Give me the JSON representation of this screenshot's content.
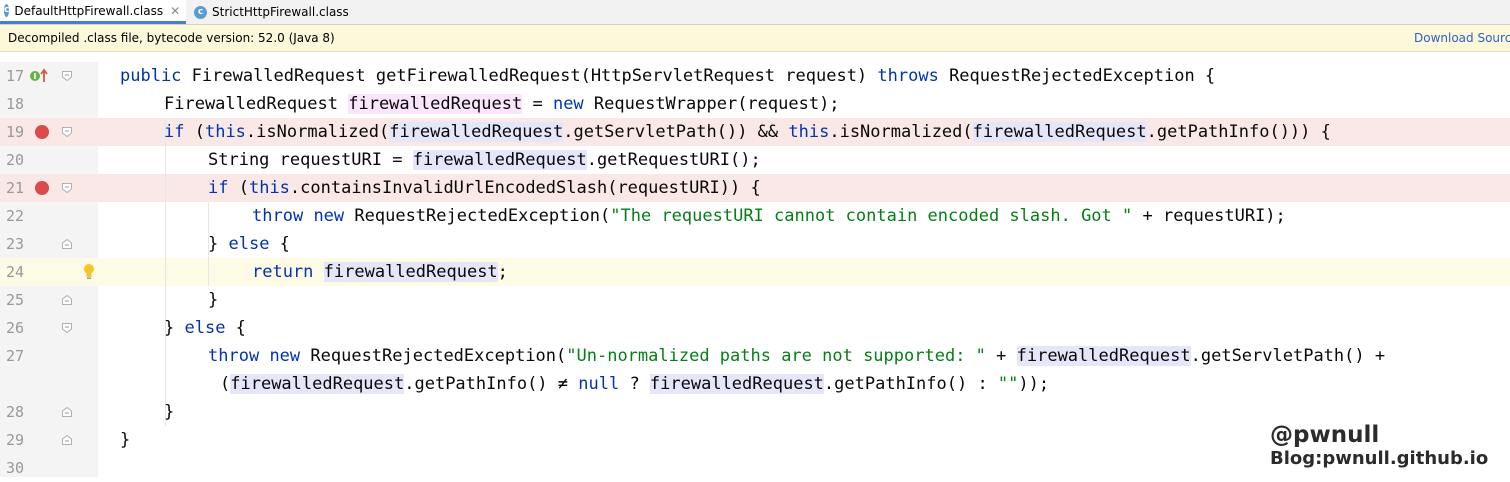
{
  "tabs": [
    {
      "label": "DefaultHttpFirewall.class",
      "icon": "class-file-icon",
      "close": "✕",
      "active": true
    },
    {
      "label": "StrictHttpFirewall.class",
      "icon": "class-file-icon",
      "close": "",
      "active": false
    }
  ],
  "banner": {
    "message": "Decompiled .class file, bytecode version: 52.0 (Java 8)",
    "link": "Download Sources"
  },
  "lines": [
    {
      "num": "17"
    },
    {
      "num": "18"
    },
    {
      "num": "19"
    },
    {
      "num": "20"
    },
    {
      "num": "21"
    },
    {
      "num": "22"
    },
    {
      "num": "23"
    },
    {
      "num": "24"
    },
    {
      "num": "25"
    },
    {
      "num": "26"
    },
    {
      "num": "27"
    },
    {
      "num": ""
    },
    {
      "num": "28"
    },
    {
      "num": "29"
    },
    {
      "num": "30"
    }
  ],
  "code": {
    "l17": [
      "public",
      " FirewalledRequest getFirewalledRequest(HttpServletRequest request) ",
      "throws",
      " RequestRejectedException {"
    ],
    "l18": [
      "FirewalledRequest ",
      "firewalledRequest",
      " = ",
      "new",
      " RequestWrapper(request);"
    ],
    "l19": [
      "if",
      " (",
      "this",
      ".isNormalized(",
      "firewalledRequest",
      ".getServletPath()) && ",
      "this",
      ".isNormalized(",
      "firewalledRequest",
      ".getPathInfo())) {"
    ],
    "l20": [
      "String requestURI = ",
      "firewalledRequest",
      ".getRequestURI();"
    ],
    "l21": [
      "if",
      " (",
      "this",
      ".containsInvalidUrlEncodedSlash(requestURI)) {"
    ],
    "l22": [
      "throw",
      " ",
      "new",
      " RequestRejectedException(",
      "\"The requestURI cannot contain encoded slash. Got \"",
      " + requestURI);"
    ],
    "l23": [
      "} ",
      "else",
      " {"
    ],
    "l24": [
      "return",
      " ",
      "firewalledRequest",
      ";"
    ],
    "l25": [
      "}"
    ],
    "l26": [
      "} ",
      "else",
      " {"
    ],
    "l27": [
      "throw",
      " ",
      "new",
      " RequestRejectedException(",
      "\"Un-normalized paths are not supported: \"",
      " + ",
      "firewalledRequest",
      ".getServletPath() +"
    ],
    "l27b": [
      "(",
      "firewalledRequest",
      ".getPathInfo() ≠ ",
      "null",
      " ? ",
      "firewalledRequest",
      ".getPathInfo() : ",
      "\"\"",
      "));"
    ],
    "l28": [
      "}"
    ],
    "l29": [
      "}"
    ]
  },
  "watermark": {
    "handle": "@pwnull",
    "blog": "Blog:pwnull.github.io"
  },
  "colors": {
    "keyword": "#0033b3",
    "string": "#067d17",
    "breakpoint": "#db4b4b",
    "breakpoint_line": "#fae8e6",
    "current_line": "#fdfbe6",
    "usage_highlight": "#e6e6fa"
  }
}
